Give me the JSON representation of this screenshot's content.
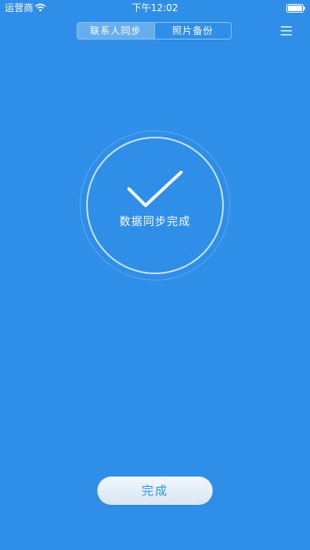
{
  "status_bar": {
    "carrier": "运营商",
    "time": "下午12:02",
    "wifi_icon": "wifi-icon",
    "battery_icon": "battery-icon"
  },
  "header": {
    "tabs": [
      {
        "label": "联系人同步",
        "active": true
      },
      {
        "label": "照片备份",
        "active": false
      }
    ],
    "menu_icon": "hamburger-menu-icon"
  },
  "main": {
    "status_icon": "checkmark-icon",
    "status_text": "数据同步完成"
  },
  "footer": {
    "done_label": "完成"
  },
  "colors": {
    "background": "#2f8fe8",
    "active_tab": "#67aef0",
    "button_text": "#2f8fe8"
  }
}
